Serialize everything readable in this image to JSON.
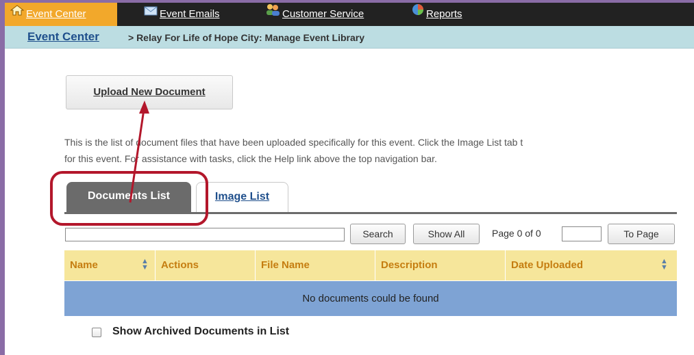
{
  "nav": {
    "items": [
      {
        "label": "Event Center",
        "icon": "home-icon"
      },
      {
        "label": "Event Emails",
        "icon": "envelope-icon"
      },
      {
        "label": "Customer Service",
        "icon": "people-icon"
      },
      {
        "label": "Reports",
        "icon": "pie-chart-icon"
      }
    ]
  },
  "breadcrumb": {
    "link": "Event Center",
    "rest": "> Relay For Life of Hope City: Manage Event Library"
  },
  "upload_button": "Upload New Document",
  "description": {
    "line1": "This is the list of document files that have been uploaded specifically for this event. Click the Image List tab t",
    "line2": "for this event. For assistance with tasks, click the Help link above the top navigation bar."
  },
  "tabs": [
    {
      "label": "Documents List",
      "active": true
    },
    {
      "label": "Image List",
      "active": false
    }
  ],
  "toolbar": {
    "search_value": "",
    "search_label": "Search",
    "show_all_label": "Show All",
    "page_label": "Page 0 of 0",
    "page_value": "",
    "to_page_label": "To Page"
  },
  "table": {
    "columns": [
      "Name",
      "Actions",
      "File Name",
      "Description",
      "Date Uploaded"
    ],
    "empty_message": "No documents could be found"
  },
  "archived": {
    "label": "Show Archived Documents in List",
    "checked": false
  },
  "colors": {
    "nav_bg": "#222222",
    "nav_active": "#f2a82b",
    "breadcrumb_bg": "#bcdde2",
    "header_bg": "#f6e69b",
    "empty_row_bg": "#7ea3d4",
    "annotation": "#b3172b"
  }
}
